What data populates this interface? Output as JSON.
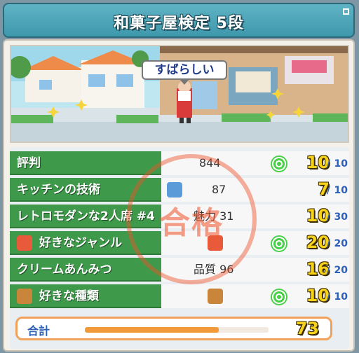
{
  "header": {
    "title": "和菓子屋検定 5段"
  },
  "scene": {
    "bubble_text": "すばらしい"
  },
  "stamp": {
    "text": "合格"
  },
  "rows": [
    {
      "label": "評判",
      "mid_value": "844",
      "score": "10",
      "max": "10",
      "icon_right": "target-icon"
    },
    {
      "label": "キッチンの技術",
      "mid_value": "87",
      "score": "7",
      "max": "10",
      "icon_mid": "face-icon"
    },
    {
      "label": "レトロモダンな2人席 #4",
      "mid_value": "魅力 31",
      "score": "10",
      "max": "30"
    },
    {
      "label": "好きなジャンル",
      "mid_value": "",
      "score": "20",
      "max": "20",
      "icon_left": "flower-icon",
      "icon_mid": "flower-icon",
      "icon_right": "target-icon"
    },
    {
      "label": "クリームあんみつ",
      "mid_value": "品質 96",
      "score": "16",
      "max": "20"
    },
    {
      "label": "好きな種類",
      "mid_value": "",
      "score": "10",
      "max": "10",
      "icon_left": "dish-icon",
      "icon_mid": "dish-icon",
      "icon_right": "target-icon"
    }
  ],
  "total": {
    "label": "合計",
    "value": "73",
    "progress_percent": 73
  },
  "colors": {
    "label_green": "#3e9a4a",
    "score_yellow": "#f6d21a",
    "stamp_red": "#f05028",
    "accent_blue": "#2d5fb8"
  }
}
